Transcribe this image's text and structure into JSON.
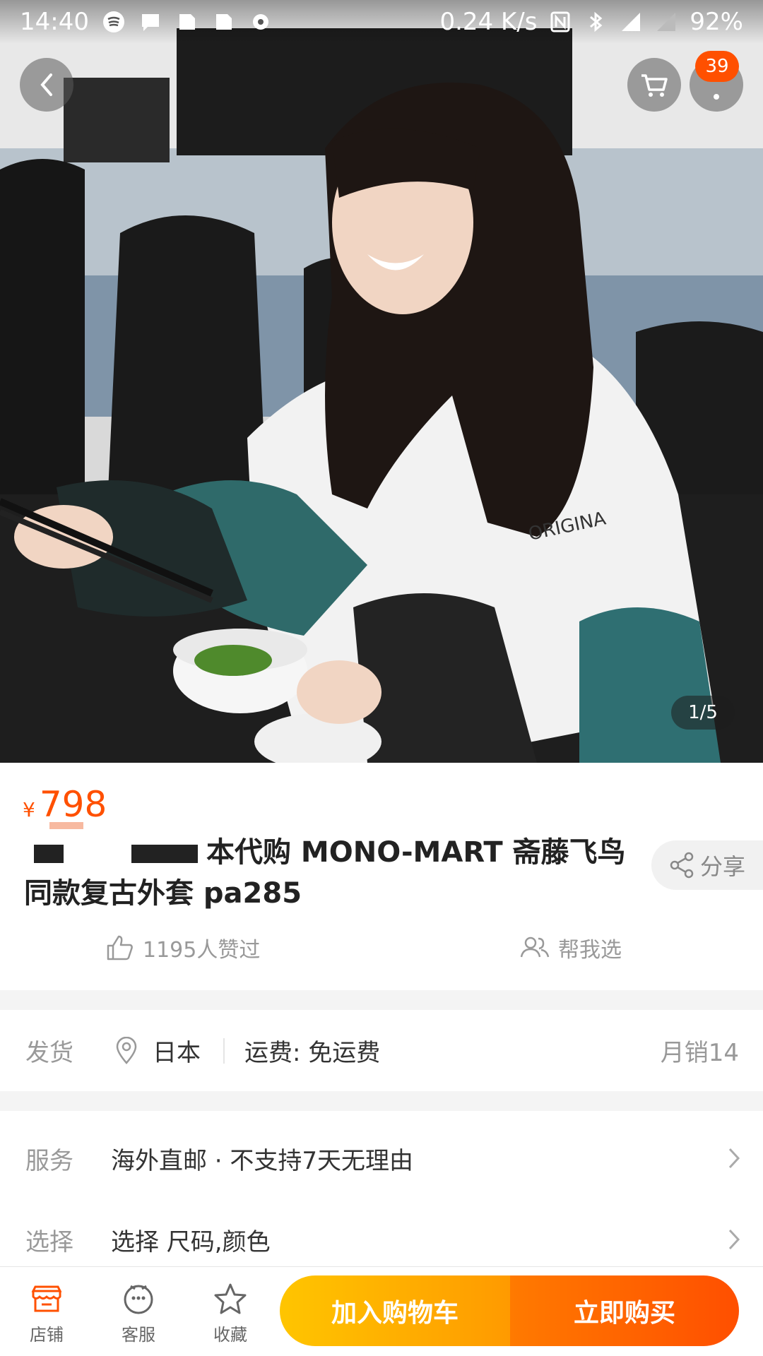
{
  "status_bar": {
    "time": "14:40",
    "net_speed": "0.24 K/s",
    "battery": "92%"
  },
  "header": {
    "cart_badge": "39",
    "pager": "1/5"
  },
  "hero": {
    "jacket_print": "ORIGINA"
  },
  "product": {
    "currency": "¥",
    "price": "798",
    "title_part": "本代购 MONO-MART 斋藤飞鸟",
    "title_line2": "同款复古外套 pa285",
    "share": "分享",
    "likes": "1195人赞过",
    "help_choose": "帮我选"
  },
  "shipping": {
    "label": "发货",
    "origin": "日本",
    "fee": "运费: 免运费",
    "monthly_sales": "月销14"
  },
  "service": {
    "label": "服务",
    "value": "海外直邮 · 不支持7天无理由"
  },
  "select": {
    "label": "选择",
    "value": "选择 尺码,颜色"
  },
  "bottom": {
    "shop": "店铺",
    "service": "客服",
    "favorite": "收藏",
    "add_cart": "加入购物车",
    "buy_now": "立即购买"
  },
  "colors": {
    "accent": "#ff5000",
    "cart_gradient": [
      "#ffc500",
      "#ff9a00"
    ],
    "buy_gradient": [
      "#ff7a00",
      "#ff4f00"
    ]
  }
}
